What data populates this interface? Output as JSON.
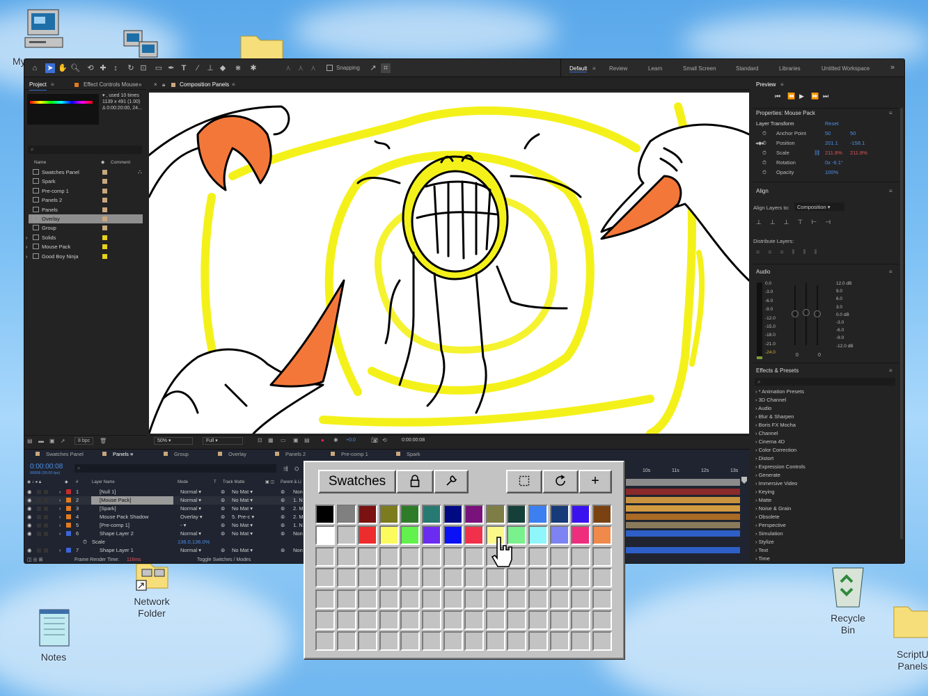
{
  "desktop": {
    "icons": {
      "my_computer": "My",
      "network_folder": "Network\nFolder",
      "notes": "Notes",
      "recycle_bin": "Recycle\nBin",
      "script_panels": "ScriptU\nPanels"
    }
  },
  "toolbar": {
    "snapping_label": "Snapping",
    "workspaces": [
      "Default",
      "Review",
      "Learn",
      "Small Screen",
      "Standard",
      "Libraries",
      "Untitled Workspace"
    ],
    "more": "»"
  },
  "project": {
    "tab_project": "Project",
    "tab_effect_controls": "Effect Controls Mouse",
    "info_line1": "▾ , used 10 times",
    "info_line2": "1139 x 491 (1.00)",
    "info_line3": "Δ 0:00:20:00, 24...",
    "col_name": "Name",
    "col_comment": "Comment",
    "items": [
      {
        "name": "Swatches Panel",
        "color": "#c9a77e"
      },
      {
        "name": "Spark",
        "color": "#c9a77e"
      },
      {
        "name": "Pre-comp 1",
        "color": "#c9a77e"
      },
      {
        "name": "Panels 2",
        "color": "#c9a77e"
      },
      {
        "name": "Panels",
        "color": "#c9a77e"
      },
      {
        "name": "Overlay",
        "color": "#c9a77e"
      },
      {
        "name": "Group",
        "color": "#c9a77e"
      },
      {
        "name": "Solids",
        "color": "#e6d21c"
      },
      {
        "name": "Mouse Pack",
        "color": "#e6d21c"
      },
      {
        "name": "Good Boy Ninja",
        "color": "#e6d21c"
      }
    ],
    "bpc": "8 bpc"
  },
  "composition": {
    "tab_label": "Composition Panels",
    "zoom": "50%",
    "resolution": "Full",
    "exposure": "+0.0",
    "timecode": "0:00:00:08"
  },
  "preview": {
    "title": "Preview"
  },
  "properties": {
    "title": "Properties: Mouse Pack",
    "section": "Layer Transform",
    "reset": "Reset",
    "rows": [
      {
        "label": "Anchor Point",
        "v1": "50",
        "v2": "50"
      },
      {
        "label": "Position",
        "v1": "201.1",
        "v2": "-158.1"
      },
      {
        "label": "Scale",
        "v1": "211.8%",
        "v2": "211.8%"
      },
      {
        "label": "Rotation",
        "v1": "0x -6.1°",
        "v2": ""
      },
      {
        "label": "Opacity",
        "v1": "100%",
        "v2": ""
      }
    ]
  },
  "align": {
    "title": "Align",
    "align_to_label": "Align Layers to:",
    "align_to_value": "Composition",
    "distribute_label": "Distribute Layers:"
  },
  "audio": {
    "title": "Audio",
    "left_scale": [
      "0.0",
      "-3.0",
      "-6.0",
      "-9.0",
      "-12.0",
      "-15.0",
      "-18.0",
      "-21.0",
      "-24.0"
    ],
    "right_scale": [
      "12.0 dB",
      "9.0",
      "6.0",
      "3.0",
      "0.0 dB",
      "-3.0",
      "-6.0",
      "-9.0",
      "-12.0 dB"
    ],
    "zero_a": "0",
    "zero_b": "0"
  },
  "effects": {
    "title": "Effects & Presets",
    "items": [
      "* Animation Presets",
      "3D Channel",
      "Audio",
      "Blur & Sharpen",
      "Boris FX Mocha",
      "Channel",
      "Cinema 4D",
      "Color Correction",
      "Distort",
      "Expression Controls",
      "Generate",
      "Immersive Video",
      "Keying",
      "Matte",
      "Noise & Grain",
      "Obsolete",
      "Perspective",
      "Simulation",
      "Stylize",
      "Text",
      "Time"
    ]
  },
  "timeline": {
    "tabs": [
      "Swatches Panel",
      "Panels",
      "Group",
      "Overlay",
      "Panels 2",
      "Pre-comp 1",
      "Spark"
    ],
    "timecode": "0:00:00:08",
    "fps": "00008 (30.00 fps)",
    "col_layer_name": "Layer Name",
    "col_mode": "Mode",
    "col_t": "T",
    "col_track_matte": "Track Matte",
    "col_parent": "Parent & Li",
    "layers": [
      {
        "num": "1",
        "name": "[Null 1]",
        "color": "#c62a2a",
        "mode": "Normal",
        "matte": "No Mat",
        "parent": "Non"
      },
      {
        "num": "2",
        "name": "[Mouse Pack]",
        "color": "#e07b1f",
        "mode": "Normal",
        "matte": "No Mat",
        "parent": "1. N"
      },
      {
        "num": "3",
        "name": "[Spark]",
        "color": "#e07b1f",
        "mode": "Normal",
        "matte": "No Mat",
        "parent": "2. M"
      },
      {
        "num": "4",
        "name": "Mouse Pack Shadow",
        "color": "#e07b1f",
        "mode": "Overlay",
        "matte": "5. Pre-c",
        "parent": "2. M"
      },
      {
        "num": "5",
        "name": "[Pre-comp 1]",
        "color": "#e07b1f",
        "mode": "-",
        "matte": "No Mat",
        "parent": "1. N"
      },
      {
        "num": "6",
        "name": "Shape Layer 2",
        "color": "#3a66d8",
        "mode": "Normal",
        "matte": "No Mat",
        "parent": "Non"
      },
      {
        "num": "7",
        "name": "Shape Layer 1",
        "color": "#3a66d8",
        "mode": "Normal",
        "matte": "No Mat",
        "parent": "Non"
      }
    ],
    "scale_label": "Scale",
    "scale_value": "136.0,136.0%",
    "render_time_label": "Frame Render Time:",
    "render_time_value": "116ms",
    "toggle_label": "Toggle Switches / Modes",
    "ruler": [
      "10s",
      "11s",
      "12s",
      "13s"
    ]
  },
  "swatches": {
    "title": "Swatches",
    "lock_icon": "lock-icon",
    "wrench_icon": "wrench-icon",
    "select_icon": "marquee-select-icon",
    "refresh_icon": "refresh-icon",
    "add_label": "+",
    "row1": [
      "#000000",
      "#808080",
      "#7b1111",
      "#7c7c1f",
      "#2e7b2a",
      "#277a72",
      "#000a83",
      "#7a127b",
      "#7e7d46",
      "#15403a",
      "#3b7ff0",
      "#173a78",
      "#3a12f0",
      "#7a4213"
    ],
    "row2": [
      "#ffffff",
      "#c3c3c3",
      "#ed2d2d",
      "#fbfb5e",
      "#63f24d",
      "#6a2cf0",
      "#0a11f5",
      "#f1314a",
      "#fbf98a",
      "#79f28d",
      "#8ff6fb",
      "#7e83f3",
      "#ee2d7d",
      "#f08a4b"
    ]
  }
}
